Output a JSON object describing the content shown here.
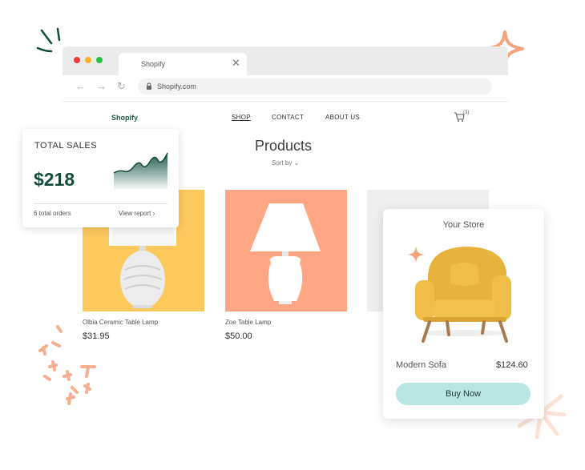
{
  "browser": {
    "tab_title": "Shopify",
    "url": "Shopify.com",
    "controls": [
      "close",
      "minimize",
      "maximize"
    ]
  },
  "site": {
    "logo": "Shopify",
    "menu": [
      "SHOP",
      "CONTACT",
      "ABOUT US"
    ],
    "active_menu": "SHOP",
    "cart_count": "(3)"
  },
  "page": {
    "title": "Products",
    "sort_label": "Sort by"
  },
  "products": [
    {
      "name": "Olbia Ceramic Table Lamp",
      "price": "$31.95",
      "bg": "#fdc85c"
    },
    {
      "name": "Zoe Table Lamp",
      "price": "$50.00",
      "bg": "#ffa784"
    }
  ],
  "sales_card": {
    "label": "TOTAL SALES",
    "value": "$218",
    "orders": "6 total orders",
    "view_report": "View report"
  },
  "store_card": {
    "title": "Your Store",
    "product_name": "Modern Sofa",
    "product_price": "$124.60",
    "buy_label": "Buy Now"
  },
  "colors": {
    "brand_green": "#1f5c46",
    "accent_teal": "#b9e5e2",
    "decor_orange": "#f7a27c"
  }
}
